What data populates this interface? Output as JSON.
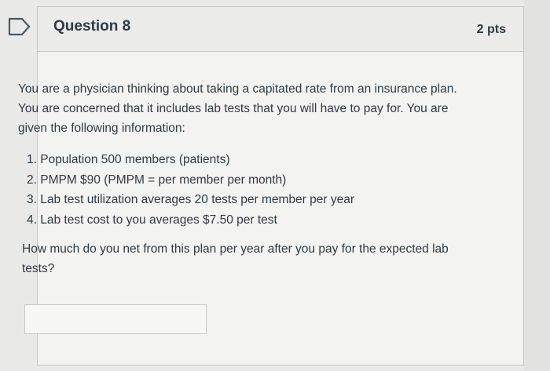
{
  "question": {
    "title": "Question 8",
    "points": "2 pts",
    "prompt": "You are a physician thinking about taking a capitated rate from an insurance plan. You are concerned that it includes lab tests that you will have to pay for. You are given the following information:",
    "info_items": [
      "1. Population 500 members (patients)",
      "2. PMPM $90 (PMPM = per member per month)",
      "3. Lab test utilization averages 20 tests per member per year",
      "4. Lab test cost to you averages $7.50 per test"
    ],
    "ask": "How much do you net from this plan per year after you pay for the expected lab tests?",
    "answer_value": ""
  },
  "icons": {
    "flag": "flag-outline-icon"
  },
  "colors": {
    "text": "#2d3b45",
    "card_background": "#f3f3f1",
    "header_background": "#ebebea",
    "border": "#c7c7c5"
  }
}
